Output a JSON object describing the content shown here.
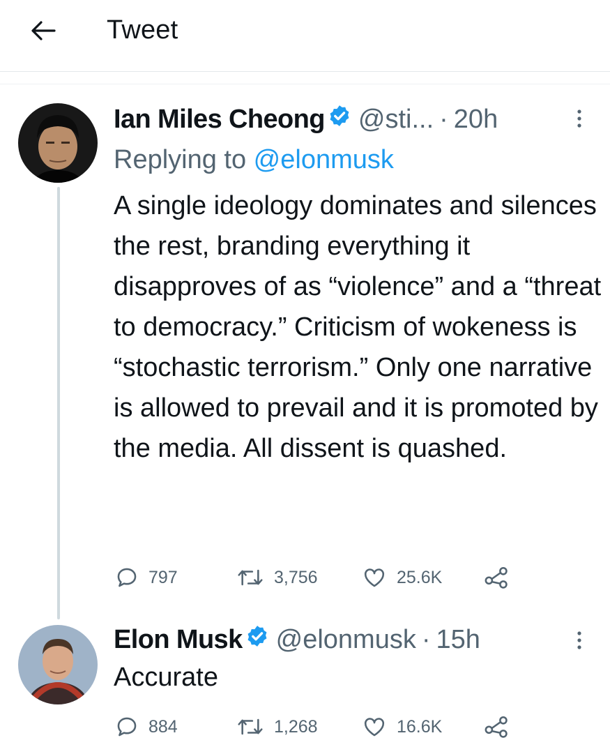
{
  "header": {
    "title": "Tweet"
  },
  "tweet": {
    "name": "Ian Miles Cheong",
    "handle": "@sti...",
    "dot": "·",
    "time": "20h",
    "replying_prefix": "Replying to ",
    "replying_to": "@elonmusk",
    "text": "A single ideology dominates and silences the rest, branding everything it disapproves of as “violence” and a “threat to democracy.” Criticism of wokeness is “stochastic terrorism.” Only one narrative is allowed to prevail and it is promoted by the media. All dissent is quashed.",
    "stats": {
      "replies": "797",
      "retweets": "3,756",
      "likes": "25.6K"
    }
  },
  "reply": {
    "name": "Elon Musk",
    "handle": "@elonmusk",
    "dot": "·",
    "time": "15h",
    "text": "Accurate",
    "stats": {
      "replies": "884",
      "retweets": "1,268",
      "likes": "16.6K"
    }
  },
  "colors": {
    "verified": "#1d9bf0",
    "secondary_text": "#536471",
    "primary_text": "#0f1419",
    "link": "#1d9bf0"
  },
  "icons": [
    "back-arrow-icon",
    "verified-badge-icon",
    "more-icon",
    "reply-icon",
    "retweet-icon",
    "like-icon",
    "share-icon"
  ]
}
